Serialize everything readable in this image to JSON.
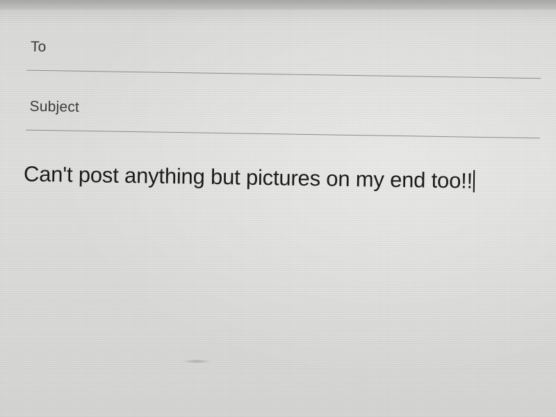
{
  "compose": {
    "to_label": "To",
    "to_value": "",
    "subject_label": "Subject",
    "subject_value": "",
    "body_text": "Can't post anything but pictures on my end too!!"
  },
  "colors": {
    "background": "#dededc",
    "label_text": "#3a3a3a",
    "body_text": "#1c1c1c",
    "divider": "#8e8f8d"
  }
}
